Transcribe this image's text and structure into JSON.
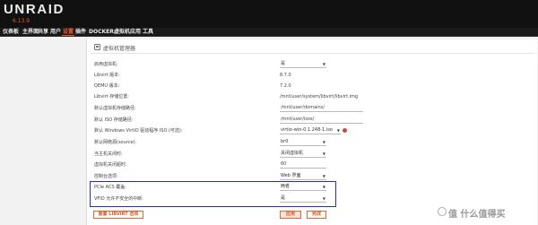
{
  "header": {
    "logo": "UNRAID",
    "version": "6.13.9"
  },
  "nav": [
    {
      "label": "仪表板"
    },
    {
      "label": "主界面"
    },
    {
      "label": "共享"
    },
    {
      "label": "用户"
    },
    {
      "label": "设置"
    },
    {
      "label": "插件"
    },
    {
      "label": "DOCKER"
    },
    {
      "label": "虚拟机"
    },
    {
      "label": "应用"
    },
    {
      "label": "工具"
    }
  ],
  "panel": {
    "title": "虚拟机管理器"
  },
  "rows": {
    "enable_vm": {
      "label": "启用虚拟机:",
      "value": "是"
    },
    "libvirt_version": {
      "label": "Libvirt 版本:",
      "value": "8.7.0"
    },
    "qemu_version": {
      "label": "QEMU 版本:",
      "value": "7.2.0"
    },
    "libvirt_storage": {
      "label": "Libvirt 存储位置:",
      "value": "/mnt/user/system/libvirt/libvirt.img"
    },
    "default_vm_path": {
      "label": "默认虚拟机存储路径:",
      "value": "/mnt/user/domains/"
    },
    "default_iso_path": {
      "label": "默认 ISO 存储路径:",
      "value": "/mnt/user/isos/"
    },
    "virtio_iso": {
      "label": "默认 Windows VirtIO 驱动程序 ISO (可选):",
      "value": "virtio-win-0.1.248-1.iso"
    },
    "network_source": {
      "label": "默认网络源(source):",
      "value": "br0"
    },
    "host_shutdown": {
      "label": "当主机关闭时:",
      "value": "关闭虚拟机"
    },
    "shutdown_timeout": {
      "label": "虚拟机关闭超时:",
      "value": "60"
    },
    "console_option": {
      "label": "控制台选项:",
      "value": "Web 界面"
    },
    "pcie_acs": {
      "label": "PCIe ACS 覆盖:",
      "value": "两者"
    },
    "vfio_interrupts": {
      "label": "VFIO 允许不安全的中断:",
      "value": "是"
    }
  },
  "buttons": {
    "default": "重置 LIBVIRT 选项",
    "apply": "应用",
    "done": "完成"
  },
  "watermark": "值 什么值得买"
}
